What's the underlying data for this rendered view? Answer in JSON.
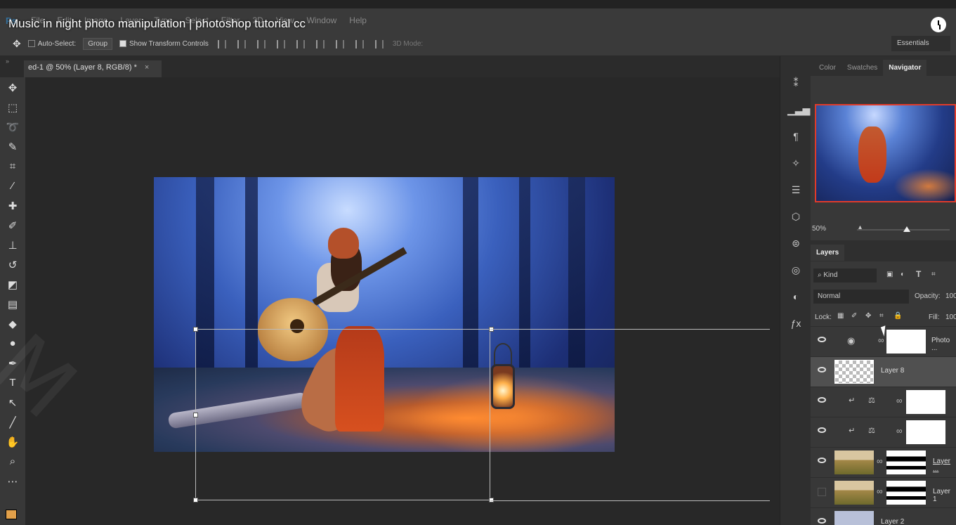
{
  "video": {
    "title": "Music in night photo manipulation | photoshop tutorial cc"
  },
  "menu": {
    "logo": "Ps",
    "items": [
      "File",
      "Edit",
      "Image",
      "Layer",
      "Type",
      "Select",
      "Filter",
      "3D",
      "View",
      "Window",
      "Help"
    ]
  },
  "options": {
    "auto_select_label": "Auto-Select:",
    "auto_select_value": "Group",
    "show_transform_label": "Show Transform Controls",
    "mode_3d_label": "3D Mode:",
    "workspace": "Essentials"
  },
  "document": {
    "tab_title": "ed-1 @ 50% (Layer 8, RGB/8) *",
    "close": "×"
  },
  "toolbar": {
    "tools": [
      "move-tool",
      "marquee-tool",
      "lasso-tool",
      "quick-select-tool",
      "crop-tool",
      "eyedropper-tool",
      "healing-tool",
      "brush-tool",
      "stamp-tool",
      "history-brush-tool",
      "eraser-tool",
      "gradient-tool",
      "blur-tool",
      "dodge-tool",
      "pen-tool",
      "type-tool",
      "path-select-tool",
      "line-tool",
      "hand-tool",
      "zoom-tool",
      "more-tools"
    ],
    "fg_color": "#e2a04a"
  },
  "panels": {
    "tabs": [
      "Color",
      "Swatches",
      "Navigator"
    ],
    "active_tab": "Navigator",
    "zoom": "50%",
    "layers_tab": "Layers",
    "filter_kind": "Kind",
    "blend_mode": "Normal",
    "opacity_label": "Opacity:",
    "opacity_value": "100",
    "lock_label": "Lock:",
    "fill_label": "Fill:",
    "fill_value": "100"
  },
  "layers": [
    {
      "name": "Photo ...",
      "kind": "adjustment-photo",
      "visible": true
    },
    {
      "name": "Layer 8",
      "kind": "pixel",
      "visible": true,
      "selected": true
    },
    {
      "name": "",
      "kind": "adjustment-balance",
      "visible": true
    },
    {
      "name": "",
      "kind": "adjustment-balance",
      "visible": true
    },
    {
      "name": "Layer ...",
      "kind": "pixel-masked",
      "visible": true
    },
    {
      "name": "Layer 1",
      "kind": "pixel-masked",
      "visible": false
    },
    {
      "name": "Layer 2",
      "kind": "pixel",
      "visible": true
    }
  ]
}
